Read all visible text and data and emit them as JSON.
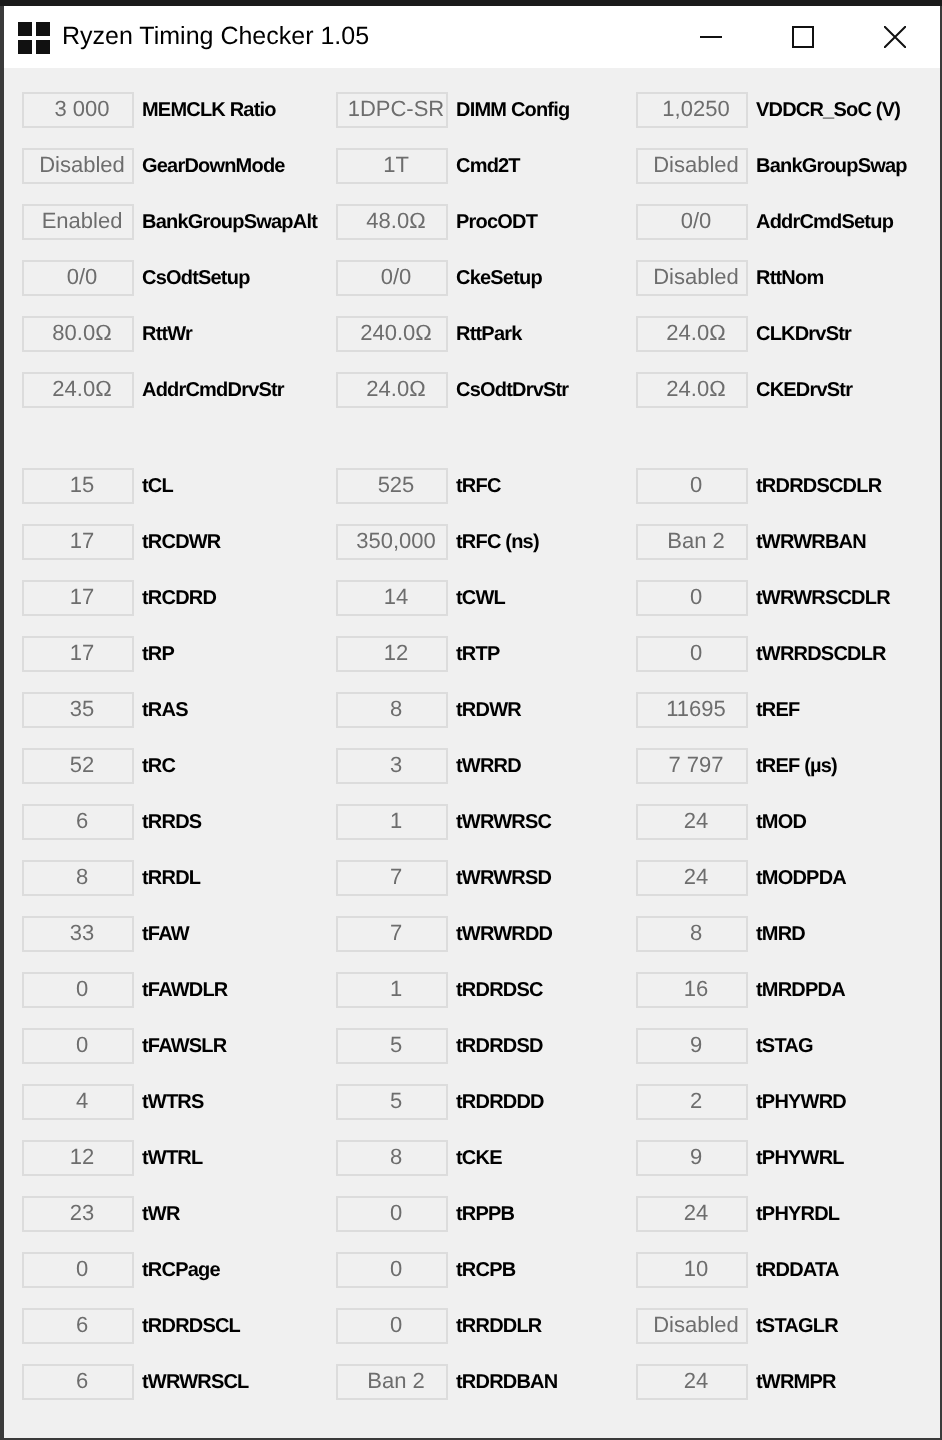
{
  "window": {
    "title": "Ryzen Timing Checker 1.05"
  },
  "sections": [
    {
      "items": [
        {
          "value": "3 000",
          "label": "MEMCLK Ratio"
        },
        {
          "value": "1DPC-SR",
          "label": "DIMM Config"
        },
        {
          "value": "1,0250",
          "label": "VDDCR_SoC (V)"
        },
        {
          "value": "Disabled",
          "label": "GearDownMode"
        },
        {
          "value": "1T",
          "label": "Cmd2T"
        },
        {
          "value": "Disabled",
          "label": "BankGroupSwap"
        },
        {
          "value": "Enabled",
          "label": "BankGroupSwapAlt"
        },
        {
          "value": "48.0Ω",
          "label": "ProcODT"
        },
        {
          "value": "0/0",
          "label": "AddrCmdSetup"
        },
        {
          "value": "0/0",
          "label": "CsOdtSetup"
        },
        {
          "value": "0/0",
          "label": "CkeSetup"
        },
        {
          "value": "Disabled",
          "label": "RttNom"
        },
        {
          "value": "80.0Ω",
          "label": "RttWr"
        },
        {
          "value": "240.0Ω",
          "label": "RttPark"
        },
        {
          "value": "24.0Ω",
          "label": "CLKDrvStr"
        },
        {
          "value": "24.0Ω",
          "label": "AddrCmdDrvStr"
        },
        {
          "value": "24.0Ω",
          "label": "CsOdtDrvStr"
        },
        {
          "value": "24.0Ω",
          "label": "CKEDrvStr"
        }
      ]
    },
    {
      "items": [
        {
          "value": "15",
          "label": "tCL"
        },
        {
          "value": "525",
          "label": "tRFC"
        },
        {
          "value": "0",
          "label": "tRDRDSCDLR"
        },
        {
          "value": "17",
          "label": "tRCDWR"
        },
        {
          "value": "350,000",
          "label": "tRFC (ns)"
        },
        {
          "value": "Ban 2",
          "label": "tWRWRBAN"
        },
        {
          "value": "17",
          "label": "tRCDRD"
        },
        {
          "value": "14",
          "label": "tCWL"
        },
        {
          "value": "0",
          "label": "tWRWRSCDLR"
        },
        {
          "value": "17",
          "label": "tRP"
        },
        {
          "value": "12",
          "label": "tRTP"
        },
        {
          "value": "0",
          "label": "tWRRDSCDLR"
        },
        {
          "value": "35",
          "label": "tRAS"
        },
        {
          "value": "8",
          "label": "tRDWR"
        },
        {
          "value": "11695",
          "label": "tREF"
        },
        {
          "value": "52",
          "label": "tRC"
        },
        {
          "value": "3",
          "label": "tWRRD"
        },
        {
          "value": "7 797",
          "label": "tREF (µs)"
        },
        {
          "value": "6",
          "label": "tRRDS"
        },
        {
          "value": "1",
          "label": "tWRWRSC"
        },
        {
          "value": "24",
          "label": "tMOD"
        },
        {
          "value": "8",
          "label": "tRRDL"
        },
        {
          "value": "7",
          "label": "tWRWRSD"
        },
        {
          "value": "24",
          "label": "tMODPDA"
        },
        {
          "value": "33",
          "label": "tFAW"
        },
        {
          "value": "7",
          "label": "tWRWRDD"
        },
        {
          "value": "8",
          "label": "tMRD"
        },
        {
          "value": "0",
          "label": "tFAWDLR"
        },
        {
          "value": "1",
          "label": "tRDRDSC"
        },
        {
          "value": "16",
          "label": "tMRDPDA"
        },
        {
          "value": "0",
          "label": "tFAWSLR"
        },
        {
          "value": "5",
          "label": "tRDRDSD"
        },
        {
          "value": "9",
          "label": "tSTAG"
        },
        {
          "value": "4",
          "label": "tWTRS"
        },
        {
          "value": "5",
          "label": "tRDRDDD"
        },
        {
          "value": "2",
          "label": "tPHYWRD"
        },
        {
          "value": "12",
          "label": "tWTRL"
        },
        {
          "value": "8",
          "label": "tCKE"
        },
        {
          "value": "9",
          "label": "tPHYWRL"
        },
        {
          "value": "23",
          "label": "tWR"
        },
        {
          "value": "0",
          "label": "tRPPB"
        },
        {
          "value": "24",
          "label": "tPHYRDL"
        },
        {
          "value": "0",
          "label": "tRCPage"
        },
        {
          "value": "0",
          "label": "tRCPB"
        },
        {
          "value": "10",
          "label": "tRDDATA"
        },
        {
          "value": "6",
          "label": "tRDRDSCL"
        },
        {
          "value": "0",
          "label": "tRRDDLR"
        },
        {
          "value": "Disabled",
          "label": "tSTAGLR"
        },
        {
          "value": "6",
          "label": "tWRWRSCL"
        },
        {
          "value": "Ban 2",
          "label": "tRDRDBAN"
        },
        {
          "value": "24",
          "label": "tWRMPR"
        }
      ]
    }
  ]
}
